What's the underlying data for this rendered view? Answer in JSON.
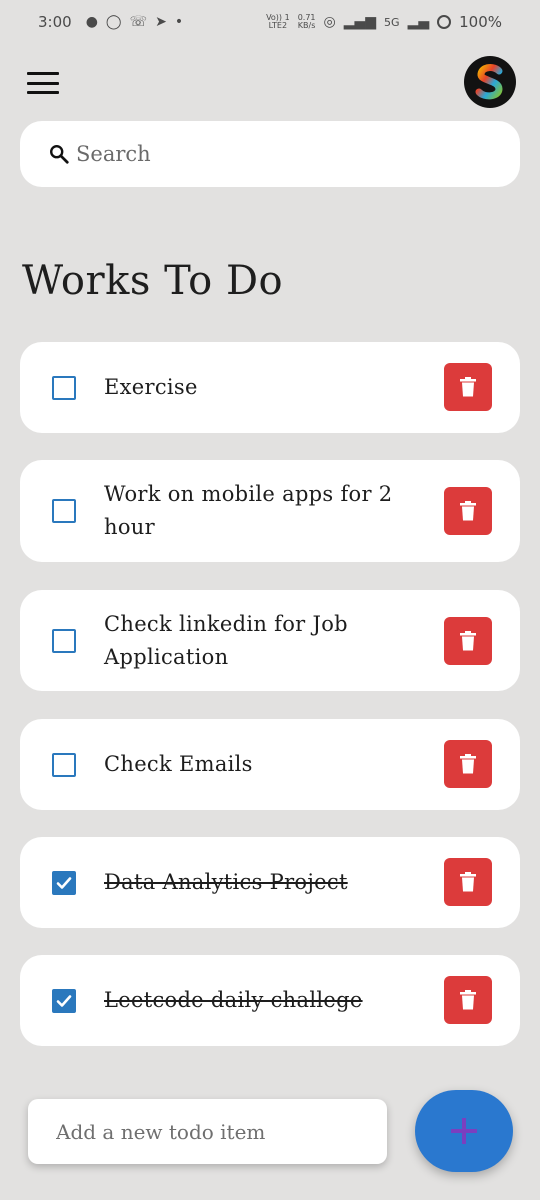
{
  "status_bar": {
    "time": "3:00",
    "network_top": "Vo)) 1",
    "network_bottom": "LTE2",
    "speed_top": "0.71",
    "speed_bottom": "KB/s",
    "network_type": "5G",
    "battery": "100%"
  },
  "header": {
    "avatar_letter": "S"
  },
  "search": {
    "placeholder": "Search"
  },
  "page": {
    "title": "Works To Do"
  },
  "todos": [
    {
      "label": "Exercise",
      "done": false
    },
    {
      "label": "Work on mobile apps for 2 hour",
      "done": false
    },
    {
      "label": "Check linkedin for Job Application",
      "done": false
    },
    {
      "label": "Check Emails",
      "done": false
    },
    {
      "label": "Data Analytics Project",
      "done": true
    },
    {
      "label": "Leetcode daily challege",
      "done": true
    }
  ],
  "new_todo": {
    "placeholder": "Add a new todo item"
  },
  "icons": {
    "menu": "hamburger-menu-icon",
    "search": "search-icon",
    "delete": "trash-icon",
    "add": "plus-icon",
    "check": "checkmark-icon"
  },
  "colors": {
    "background": "#e2e1e0",
    "card": "#ffffff",
    "checkbox": "#2a78bd",
    "delete": "#dc3b3b",
    "fab": "#2a78cf",
    "fab_plus": "#7b3fbf"
  }
}
